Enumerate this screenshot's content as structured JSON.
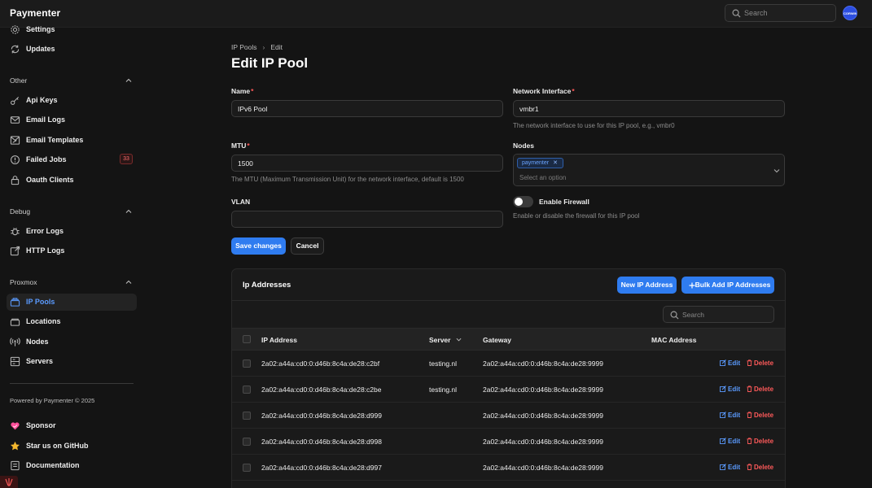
{
  "app": {
    "brand": "Paymenter",
    "search_placeholder": "Search",
    "avatar_text": "CORWIN"
  },
  "sidebar": {
    "top_items": [
      {
        "label": "Settings",
        "icon": "gear-icon"
      },
      {
        "label": "Updates",
        "icon": "refresh-icon"
      }
    ],
    "groups": [
      {
        "title": "Other",
        "items": [
          {
            "label": "Api Keys",
            "icon": "key-icon"
          },
          {
            "label": "Email Logs",
            "icon": "envelope-icon"
          },
          {
            "label": "Email Templates",
            "icon": "envelope-edit-icon"
          },
          {
            "label": "Failed Jobs",
            "icon": "alert-circle-icon",
            "badge": "33"
          },
          {
            "label": "Oauth Clients",
            "icon": "lock-icon"
          }
        ]
      },
      {
        "title": "Debug",
        "items": [
          {
            "label": "Error Logs",
            "icon": "bug-icon"
          },
          {
            "label": "HTTP Logs",
            "icon": "external-link-icon"
          }
        ]
      },
      {
        "title": "Proxmox",
        "items": [
          {
            "label": "IP Pools",
            "icon": "stack-icon",
            "active": true
          },
          {
            "label": "Locations",
            "icon": "location-icon"
          },
          {
            "label": "Nodes",
            "icon": "signal-icon"
          },
          {
            "label": "Servers",
            "icon": "server-icon"
          }
        ]
      }
    ],
    "powered_by": "Powered by Paymenter © 2025",
    "footer_items": [
      {
        "label": "Sponsor",
        "icon": "heart-icon",
        "color": "#ff4f9a"
      },
      {
        "label": "Star us on GitHub",
        "icon": "star-icon",
        "color": "#f5b82e"
      },
      {
        "label": "Documentation",
        "icon": "book-icon"
      }
    ]
  },
  "breadcrumb": {
    "parent": "IP Pools",
    "current": "Edit"
  },
  "page_title": "Edit IP Pool",
  "form": {
    "name": {
      "label": "Name",
      "required": "*",
      "value": "IPv6 Pool"
    },
    "network_interface": {
      "label": "Network Interface",
      "required": "*",
      "value": "vmbr1",
      "help": "The network interface to use for this IP pool, e.g., vmbr0"
    },
    "mtu": {
      "label": "MTU",
      "required": "*",
      "value": "1500",
      "help": "The MTU (Maximum Transmission Unit) for the network interface, default is 1500"
    },
    "nodes": {
      "label": "Nodes",
      "selected_tag": "paymenter",
      "placeholder": "Select an option"
    },
    "vlan": {
      "label": "VLAN",
      "value": ""
    },
    "firewall": {
      "label": "Enable Firewall",
      "help": "Enable or disable the firewall for this IP pool",
      "enabled": false
    },
    "save_label": "Save changes",
    "cancel_label": "Cancel"
  },
  "table": {
    "title": "Ip Addresses",
    "new_button": "New IP Address",
    "bulk_button": "Bulk Add IP Addresses",
    "search_placeholder": "Search",
    "columns": [
      "IP Address",
      "Server",
      "Gateway",
      "MAC Address"
    ],
    "edit_label": "Edit",
    "delete_label": "Delete",
    "rows": [
      {
        "ip": "2a02:a44a:cd0:0:d46b:8c4a:de28:c2bf",
        "server": "testing.nl",
        "gateway": "2a02:a44a:cd0:0:d46b:8c4a:de28:9999",
        "mac": ""
      },
      {
        "ip": "2a02:a44a:cd0:0:d46b:8c4a:de28:c2be",
        "server": "testing.nl",
        "gateway": "2a02:a44a:cd0:0:d46b:8c4a:de28:9999",
        "mac": ""
      },
      {
        "ip": "2a02:a44a:cd0:0:d46b:8c4a:de28:d999",
        "server": "",
        "gateway": "2a02:a44a:cd0:0:d46b:8c4a:de28:9999",
        "mac": ""
      },
      {
        "ip": "2a02:a44a:cd0:0:d46b:8c4a:de28:d998",
        "server": "",
        "gateway": "2a02:a44a:cd0:0:d46b:8c4a:de28:9999",
        "mac": ""
      },
      {
        "ip": "2a02:a44a:cd0:0:d46b:8c4a:de28:d997",
        "server": "",
        "gateway": "2a02:a44a:cd0:0:d46b:8c4a:de28:9999",
        "mac": ""
      }
    ]
  },
  "colors": {
    "accent": "#2f7cf0",
    "danger": "#ff5a5a",
    "background": "#141414"
  }
}
